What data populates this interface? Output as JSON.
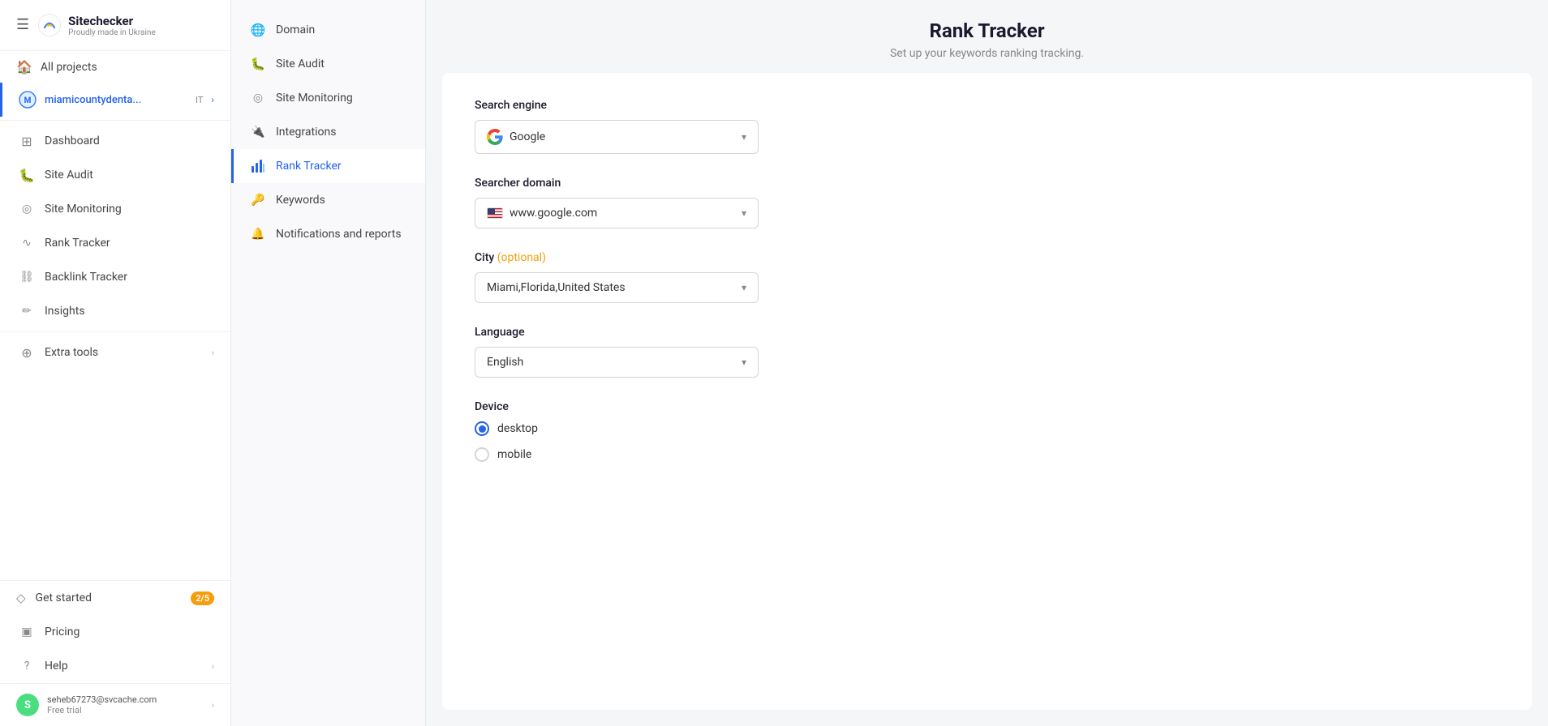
{
  "app": {
    "name": "Sitechecker",
    "tagline": "Proudly made in Ukraine"
  },
  "sidebar": {
    "all_projects_label": "All projects",
    "active_project": {
      "name": "miamicountydenta...",
      "badge": "IT",
      "arrow": "›"
    },
    "nav_items": [
      {
        "id": "dashboard",
        "label": "Dashboard",
        "icon": "grid"
      },
      {
        "id": "site-audit",
        "label": "Site Audit",
        "icon": "bug"
      },
      {
        "id": "site-monitoring",
        "label": "Site Monitoring",
        "icon": "monitor"
      },
      {
        "id": "rank-tracker",
        "label": "Rank Tracker",
        "icon": "chart"
      },
      {
        "id": "backlink-tracker",
        "label": "Backlink Tracker",
        "icon": "link"
      },
      {
        "id": "insights",
        "label": "Insights",
        "icon": "wand"
      }
    ],
    "extra_tools": {
      "label": "Extra tools",
      "arrow": "›"
    },
    "get_started": {
      "label": "Get started",
      "badge": "2/5"
    },
    "pricing": {
      "label": "Pricing"
    },
    "help": {
      "label": "Help",
      "arrow": "›"
    },
    "user": {
      "email": "seheb67273@svcache.com",
      "plan": "Free trial",
      "avatar_letter": "S",
      "arrow": "›"
    }
  },
  "subnav": {
    "items": [
      {
        "id": "domain",
        "label": "Domain",
        "icon": "globe"
      },
      {
        "id": "site-audit",
        "label": "Site Audit",
        "icon": "bug"
      },
      {
        "id": "site-monitoring",
        "label": "Site Monitoring",
        "icon": "monitor"
      },
      {
        "id": "integrations",
        "label": "Integrations",
        "icon": "plug"
      },
      {
        "id": "rank-tracker",
        "label": "Rank Tracker",
        "icon": "rank",
        "active": true
      },
      {
        "id": "keywords",
        "label": "Keywords",
        "icon": "key"
      },
      {
        "id": "notifications-reports",
        "label": "Notifications and reports",
        "icon": "bell"
      }
    ]
  },
  "main": {
    "title": "Rank Tracker",
    "subtitle": "Set up your keywords ranking tracking.",
    "form": {
      "search_engine_label": "Search engine",
      "search_engine_value": "Google",
      "searcher_domain_label": "Searcher domain",
      "searcher_domain_value": "www.google.com",
      "city_label": "City",
      "city_optional": "(optional)",
      "city_value": "Miami,Florida,United States",
      "language_label": "Language",
      "language_value": "English",
      "device_label": "Device",
      "device_options": [
        {
          "id": "desktop",
          "label": "desktop",
          "selected": true
        },
        {
          "id": "mobile",
          "label": "mobile",
          "selected": false
        }
      ]
    }
  }
}
